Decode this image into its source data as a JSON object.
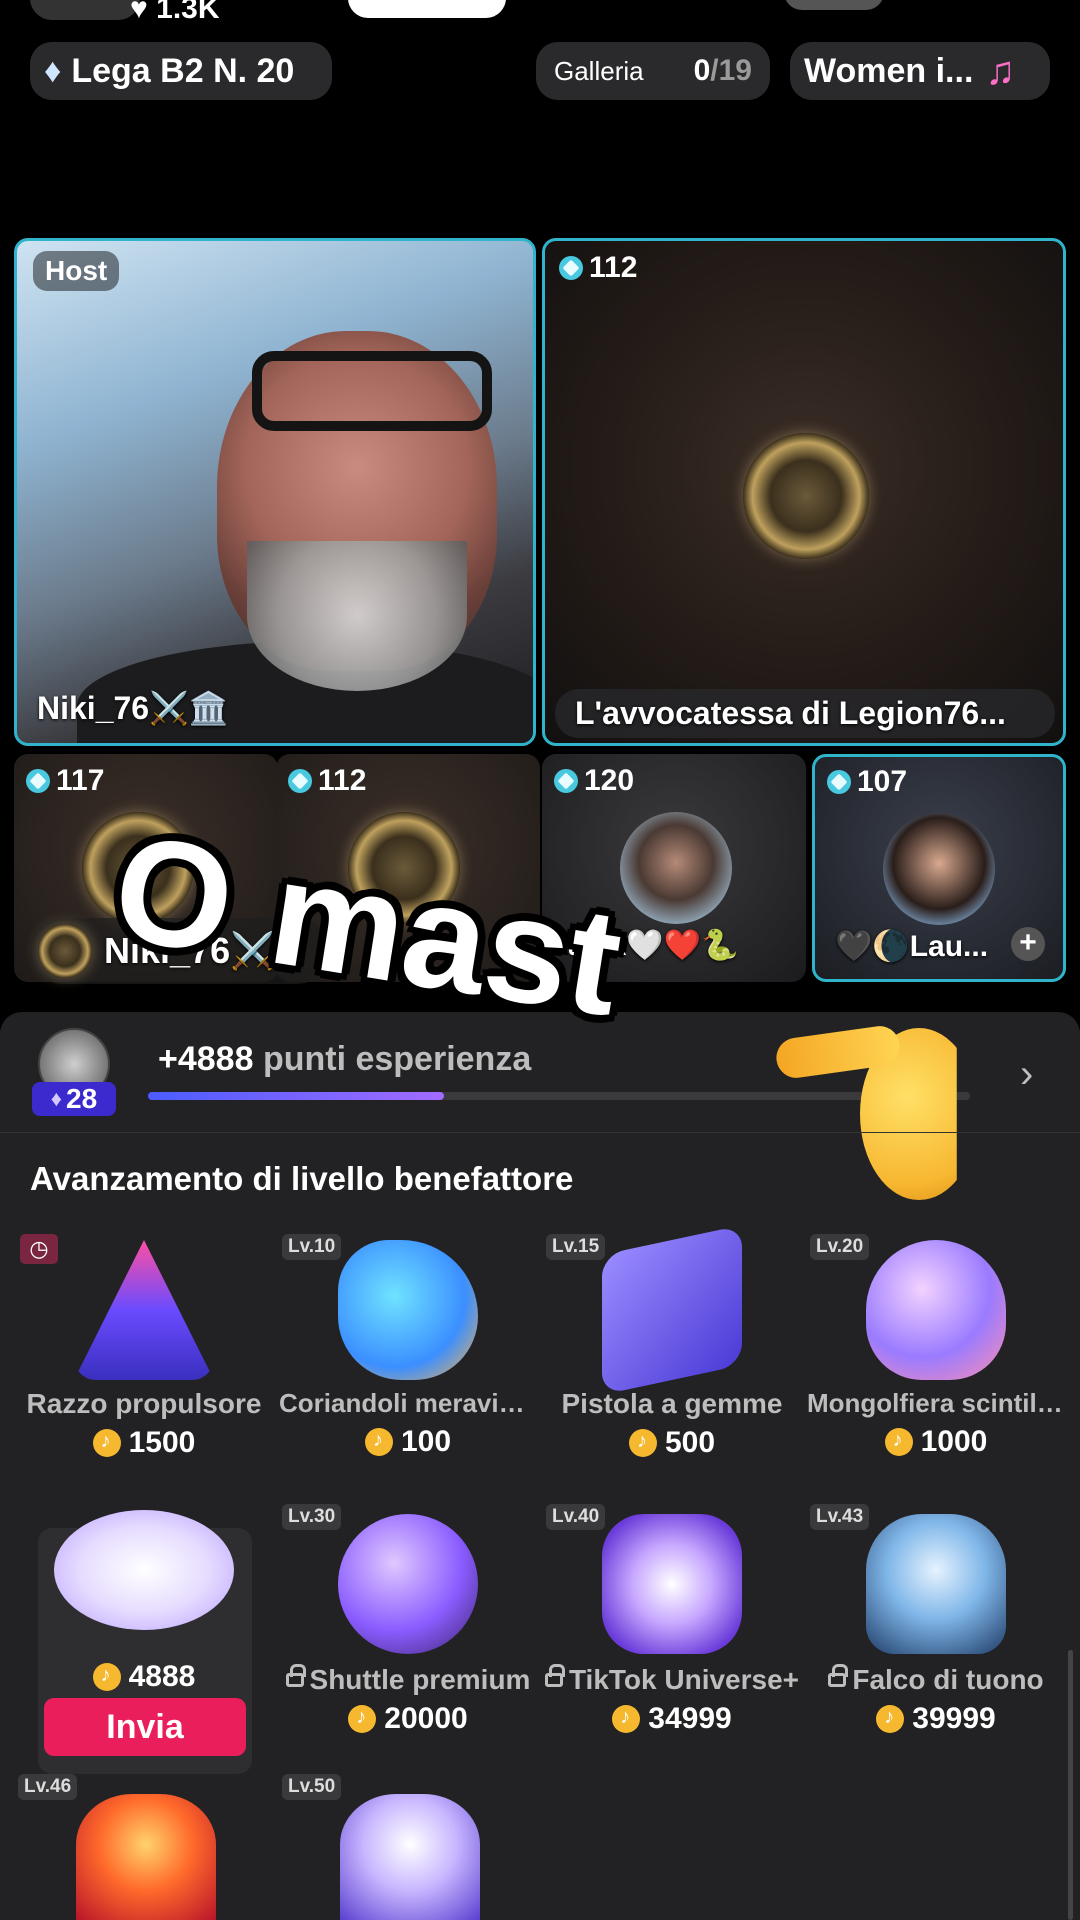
{
  "top": {
    "likes": "1.3K",
    "league": "Lega B2 N. 20",
    "gallery_label": "Galleria",
    "gallery_count": "0",
    "gallery_total": "/19",
    "song": "Women i...",
    "song_icon": "music-note-icon"
  },
  "tiles": {
    "host_label": "Host",
    "host_name": "Niki_76⚔️🏛️",
    "guest_score": "112",
    "guest_name": "L'avvocatessa di Legion76...",
    "small": [
      {
        "score": "117"
      },
      {
        "score": "112"
      },
      {
        "score": "120",
        "name": "alex🤍❤️🐍"
      },
      {
        "score": "107",
        "name": "🖤🌘Lau..."
      }
    ],
    "overlay_user": "Niki_76⚔️"
  },
  "caption": "O mast",
  "panel": {
    "user_level": "28",
    "xp_points": "+4888",
    "xp_label": "punti esperienza",
    "xp_progress": 0.36,
    "section_title": "Avanzamento di livello benefattore",
    "gifts": [
      {
        "level": "",
        "name": "Razzo propulsore",
        "price": "1500",
        "locked": false
      },
      {
        "level": "Lv.10",
        "name": "Coriandoli meravigli...",
        "price": "100",
        "locked": false
      },
      {
        "level": "Lv.15",
        "name": "Pistola a gemme",
        "price": "500",
        "locked": false
      },
      {
        "level": "Lv.20",
        "name": "Mongolfiera scintill...",
        "price": "1000",
        "locked": false
      },
      {
        "level": "",
        "name": "",
        "price": "4888",
        "locked": false
      },
      {
        "level": "Lv.30",
        "name": "Shuttle premium",
        "price": "20000",
        "locked": true
      },
      {
        "level": "Lv.40",
        "name": "TikTok Universe+",
        "price": "34999",
        "locked": true
      },
      {
        "level": "Lv.43",
        "name": "Falco di tuono",
        "price": "39999",
        "locked": true
      },
      {
        "level": "Lv.46",
        "name": "",
        "price": "",
        "locked": true
      },
      {
        "level": "Lv.50",
        "name": "",
        "price": "",
        "locked": true
      }
    ],
    "send_label": "Invia"
  }
}
